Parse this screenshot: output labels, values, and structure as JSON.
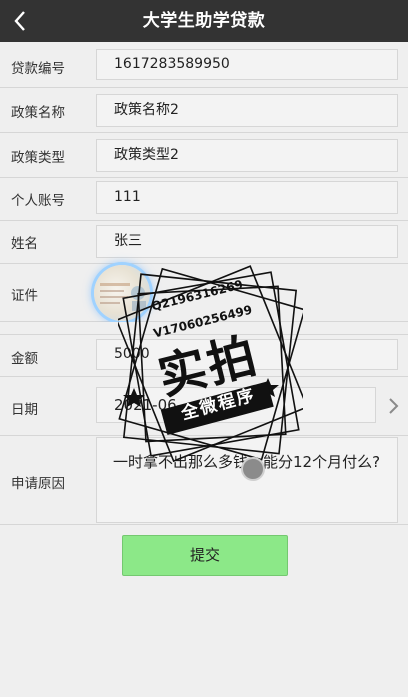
{
  "header": {
    "title": "大学生助学贷款"
  },
  "form": {
    "loan_no": {
      "label": "贷款编号",
      "value": "1617283589950"
    },
    "policy_name": {
      "label": "政策名称",
      "value": "政策名称2"
    },
    "policy_type": {
      "label": "政策类型",
      "value": "政策类型2"
    },
    "account": {
      "label": "个人账号",
      "value": "111"
    },
    "name": {
      "label": "姓名",
      "value": "张三"
    },
    "certificate": {
      "label": "证件"
    },
    "amount": {
      "label": "金额",
      "value": "5000"
    },
    "date": {
      "label": "日期",
      "value": "2021-06-"
    },
    "reason": {
      "label": "申请原因",
      "value": "一时拿不出那么多钱，能分12个月付么?"
    }
  },
  "submit": {
    "label": "提交"
  },
  "watermark": {
    "contact_q": "Q2196316269",
    "contact_v": "V17060256499",
    "big_text": "实拍",
    "banner": "全微程序"
  },
  "colors": {
    "header_bg": "#333333",
    "submit_bg": "#8ce888",
    "page_bg": "#efefef"
  }
}
